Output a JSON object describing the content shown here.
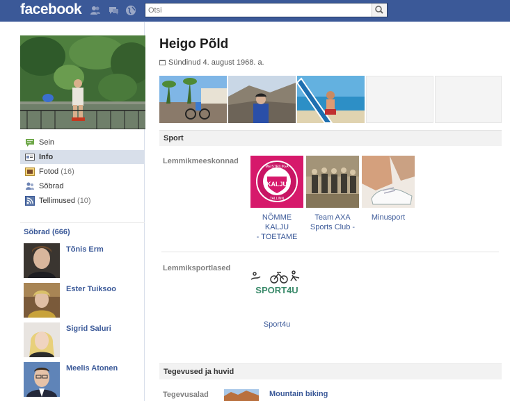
{
  "topbar": {
    "logo": "facebook",
    "search_placeholder": "Otsi",
    "search_value": ""
  },
  "profile": {
    "name": "Heigo Põld",
    "birthday": "Sündinud 4. august 1968. a."
  },
  "nav": {
    "items": [
      {
        "label": "Sein",
        "count": ""
      },
      {
        "label": "Info",
        "count": ""
      },
      {
        "label": "Fotod",
        "count": "(16)"
      },
      {
        "label": "Sõbrad",
        "count": ""
      },
      {
        "label": "Tellimused",
        "count": "(10)"
      }
    ]
  },
  "friends": {
    "title": "Sõbrad (666)",
    "list": [
      {
        "name": "Tõnis Erm"
      },
      {
        "name": "Ester Tuiksoo"
      },
      {
        "name": "Sigrid Saluri"
      },
      {
        "name": "Meelis Atonen"
      }
    ]
  },
  "sections": {
    "sport": {
      "title": "Sport",
      "teams_label": "Lemmikmeeskonnad",
      "teams": [
        {
          "name_line1": "NÕMME KALJU",
          "name_line2": "- TOETAME"
        },
        {
          "name_line1": "Team AXA",
          "name_line2": "Sports Club -"
        },
        {
          "name_line1": "Minusport",
          "name_line2": ""
        }
      ],
      "athletes_label": "Lemmiksportlased",
      "athletes": [
        {
          "name": "Sport4u",
          "logo_text": "SPORT4U"
        }
      ]
    },
    "activities": {
      "title": "Tegevused ja huvid",
      "label": "Tegevusalad",
      "items": [
        {
          "name": "Mountain biking"
        }
      ]
    }
  },
  "kalju_badge": {
    "top": "MEISTRILIIGA",
    "middle": "KALJU",
    "bottom": "TALLINN"
  },
  "colors": {
    "brand": "#3b5998",
    "link": "#3b5998",
    "selected_nav": "#d8dfea",
    "kalju_pink": "#d6196b"
  }
}
